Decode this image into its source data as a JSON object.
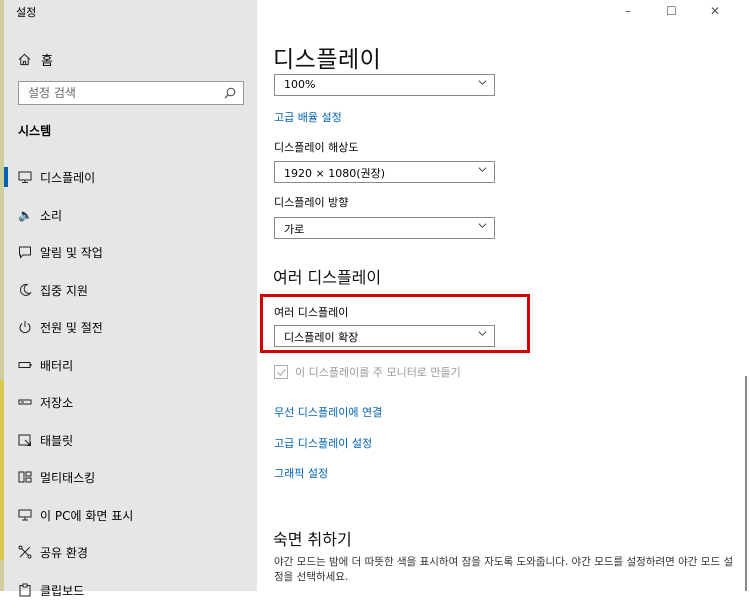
{
  "app": {
    "title": "설정",
    "window_controls": {
      "minimize": "–",
      "maximize": "☐",
      "close": "✕"
    }
  },
  "sidebar": {
    "home_label": "홈",
    "search_placeholder": "설정 검색",
    "section_title": "시스템",
    "items": [
      {
        "label": "디스플레이",
        "icon": "monitor-icon",
        "active": true
      },
      {
        "label": "소리",
        "icon": "speaker-icon",
        "active": false
      },
      {
        "label": "알림 및 작업",
        "icon": "notification-icon",
        "active": false
      },
      {
        "label": "집중 지원",
        "icon": "moon-icon",
        "active": false
      },
      {
        "label": "전원 및 절전",
        "icon": "power-icon",
        "active": false
      },
      {
        "label": "배터리",
        "icon": "battery-icon",
        "active": false
      },
      {
        "label": "저장소",
        "icon": "storage-icon",
        "active": false
      },
      {
        "label": "태블릿",
        "icon": "tablet-icon",
        "active": false
      },
      {
        "label": "멀티태스킹",
        "icon": "multitasking-icon",
        "active": false
      },
      {
        "label": "이 PC에 화면 표시",
        "icon": "project-icon",
        "active": false
      },
      {
        "label": "공유 환경",
        "icon": "shared-icon",
        "active": false
      },
      {
        "label": "클립보드",
        "icon": "clipboard-icon",
        "active": false
      }
    ]
  },
  "main": {
    "page_title": "디스플레이",
    "scale_value": "100%",
    "advanced_scaling_link": "고급 배율 설정",
    "resolution_label": "디스플레이 해상도",
    "resolution_value": "1920 × 1080(권장)",
    "orientation_label": "디스플레이 방향",
    "orientation_value": "가로",
    "multi_display_heading": "여러 디스플레이",
    "multi_display_label": "여러 디스플레이",
    "multi_display_value": "디스플레이 확장",
    "main_monitor_checkbox": "이 디스플레이를 주 모니터로 만들기",
    "wireless_link": "무선 디스플레이에 연결",
    "advanced_display_link": "고급 디스플레이 설정",
    "graphics_link": "그래픽 설정",
    "sleep_heading": "숙면 취하기",
    "sleep_description": "야간 모드는 밤에 더 따뜻한 색을 표시하여 잠을 자도록 도와줍니다. 야간 모드를 설정하려면 야간 모드 설정을 선택하세요."
  },
  "colors": {
    "accent": "#0063b1",
    "highlight": "#d40000",
    "sidebar_bg": "#e6e6e6"
  }
}
